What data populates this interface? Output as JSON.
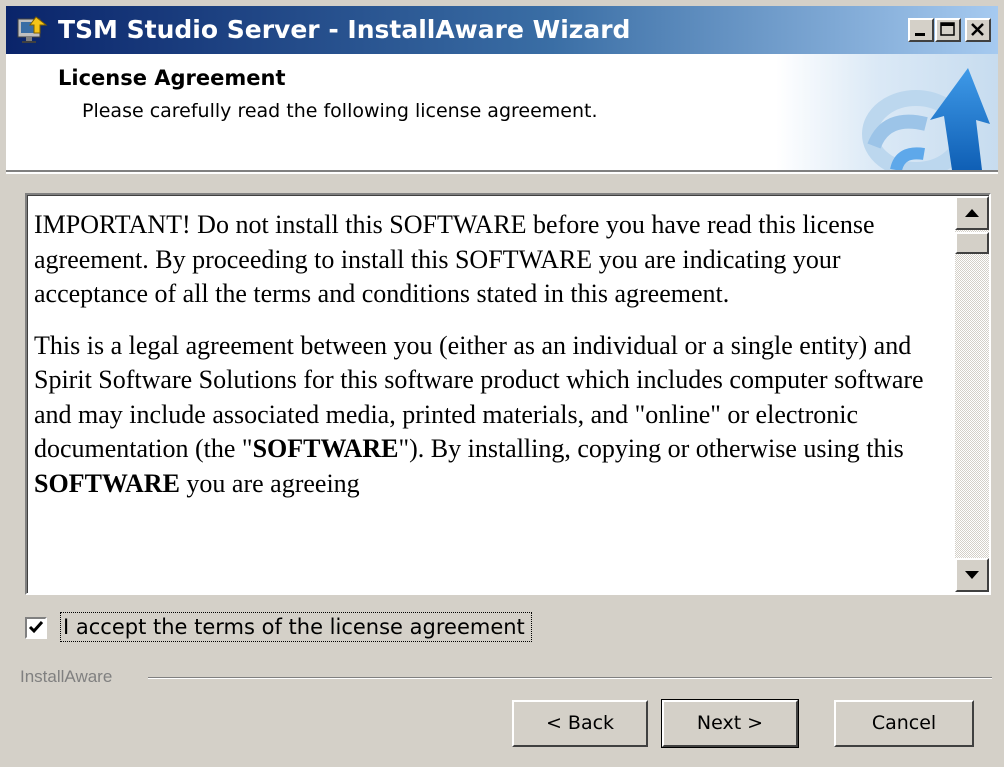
{
  "window": {
    "title": "TSM Studio Server - InstallAware Wizard"
  },
  "header": {
    "title": "License Agreement",
    "subtitle": "Please carefully read the following license agreement."
  },
  "license": {
    "p1": "IMPORTANT! Do not install this SOFTWARE before you have read this license agreement. By proceeding to install this SOFTWARE you are indicating your acceptance of all the terms and conditions stated in this agreement.",
    "p2_a": "This is a legal agreement between you (either as an individual or a single entity) and Spirit Software Solutions for this software product which includes computer software and may include associated media, printed materials, and \"online\" or electronic documentation (the \"",
    "p2_b": "SOFTWARE",
    "p2_c": "\"). By installing, copying or otherwise using this ",
    "p2_d": "SOFTWARE",
    "p2_e": " you are agreeing"
  },
  "accept": {
    "label": "I accept the terms of the license agreement",
    "checked": true
  },
  "footer": {
    "group_label": "InstallAware"
  },
  "buttons": {
    "back": "< Back",
    "next": "Next >",
    "cancel": "Cancel"
  },
  "colors": {
    "titlebar_start": "#0a246a",
    "titlebar_end": "#a6caf0",
    "face": "#d4d0c8",
    "logo_blue": "#1e7ad6"
  },
  "icons": {
    "app": "installer-icon",
    "logo": "installaware-arrow-logo",
    "minimize": "minimize-icon",
    "maximize": "maximize-icon",
    "close": "close-icon",
    "scroll_up": "arrow-up-icon",
    "scroll_down": "arrow-down-icon",
    "check": "checkmark-icon"
  }
}
